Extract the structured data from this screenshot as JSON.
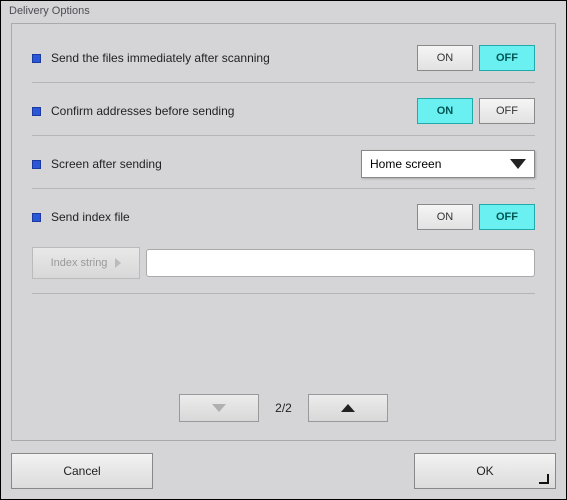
{
  "window": {
    "title": "Delivery Options"
  },
  "options": {
    "send_immediately": {
      "label": "Send the files immediately after scanning",
      "on": "ON",
      "off": "OFF",
      "value": "OFF"
    },
    "confirm_addresses": {
      "label": "Confirm addresses before sending",
      "on": "ON",
      "off": "OFF",
      "value": "ON"
    },
    "screen_after": {
      "label": "Screen after sending",
      "selected": "Home screen"
    },
    "send_index": {
      "label": "Send index file",
      "on": "ON",
      "off": "OFF",
      "value": "OFF"
    },
    "index_string": {
      "button_label": "Index string",
      "value": ""
    }
  },
  "pager": {
    "text": "2/2"
  },
  "footer": {
    "cancel": "Cancel",
    "ok": "OK"
  }
}
